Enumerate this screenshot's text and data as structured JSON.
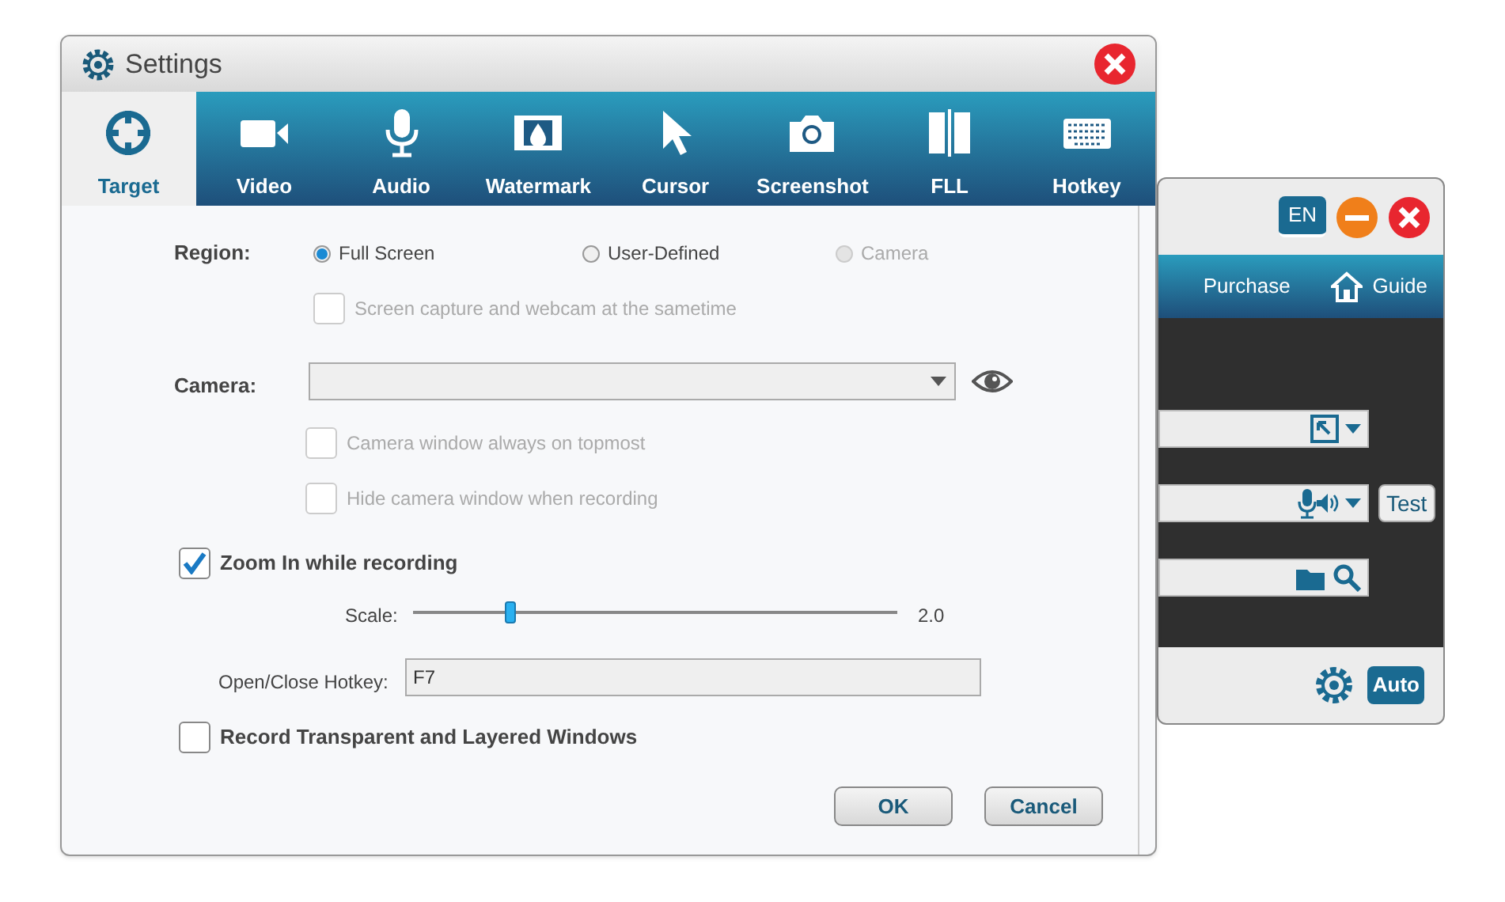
{
  "back_window": {
    "language": "EN",
    "nav": [
      {
        "label": "Purchase"
      },
      {
        "label": "Guide"
      }
    ],
    "fields": [
      {
        "kind": "region"
      },
      {
        "kind": "audio",
        "button": "Test"
      },
      {
        "kind": "folder"
      }
    ],
    "auto_button": "Auto"
  },
  "settings": {
    "title": "Settings",
    "tabs": [
      {
        "label": "Target",
        "selected": true
      },
      {
        "label": "Video",
        "selected": false
      },
      {
        "label": "Audio",
        "selected": false
      },
      {
        "label": "Watermark",
        "selected": false
      },
      {
        "label": "Cursor",
        "selected": false
      },
      {
        "label": "Screenshot",
        "selected": false
      },
      {
        "label": "FLL",
        "selected": false
      },
      {
        "label": "Hotkey",
        "selected": false
      }
    ],
    "region": {
      "label": "Region:",
      "options": [
        {
          "label": "Full Screen",
          "selected": true,
          "disabled": false
        },
        {
          "label": "User-Defined",
          "selected": false,
          "disabled": false
        },
        {
          "label": "Camera",
          "selected": false,
          "disabled": true
        }
      ]
    },
    "webcam_option": {
      "label": "Screen capture and webcam at the sametime",
      "checked": false,
      "disabled": true
    },
    "camera": {
      "label": "Camera:"
    },
    "camera_options": [
      {
        "label": "Camera window always on topmost",
        "checked": false,
        "disabled": true
      },
      {
        "label": "Hide camera window when recording",
        "checked": false,
        "disabled": true
      }
    ],
    "zoom": {
      "label": "Zoom In while recording",
      "checked": true
    },
    "scale": {
      "label": "Scale:",
      "level": 0.2,
      "reading": "2.0"
    },
    "hotkey": {
      "label": "Open/Close Hotkey:",
      "value": "F7"
    },
    "layered": {
      "label": "Record Transparent and Layered Windows",
      "checked": false
    },
    "buttons": [
      "OK",
      "Cancel"
    ]
  }
}
